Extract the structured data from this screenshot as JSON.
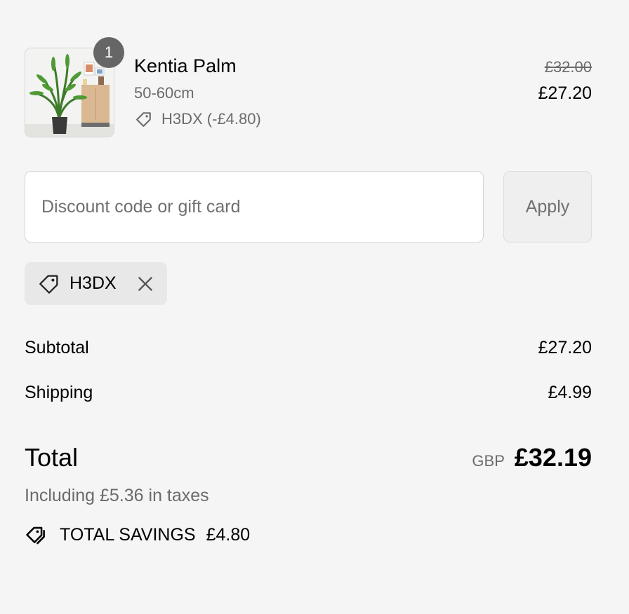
{
  "product": {
    "quantity": "1",
    "name": "Kentia Palm",
    "variant": "50-60cm",
    "discount_label": "H3DX (-£4.80)",
    "original_price": "£32.00",
    "price": "£27.20",
    "image_icon": "potted-palm-image"
  },
  "discount_form": {
    "placeholder": "Discount code or gift card",
    "value": "",
    "apply_label": "Apply"
  },
  "applied_code": {
    "code": "H3DX",
    "icon": "tag-icon",
    "remove_icon": "close-icon"
  },
  "summary": {
    "subtotal_label": "Subtotal",
    "subtotal_value": "£27.20",
    "shipping_label": "Shipping",
    "shipping_value": "£4.99",
    "total_label": "Total",
    "currency": "GBP",
    "total_value": "£32.19",
    "taxes_text": "Including £5.36 in taxes",
    "savings_label": "TOTAL SAVINGS",
    "savings_value": "£4.80"
  },
  "colors": {
    "background": "#f5f5f5",
    "muted_text": "#6b6b6b",
    "badge": "#666666",
    "chip_background": "#e8e8e8"
  }
}
